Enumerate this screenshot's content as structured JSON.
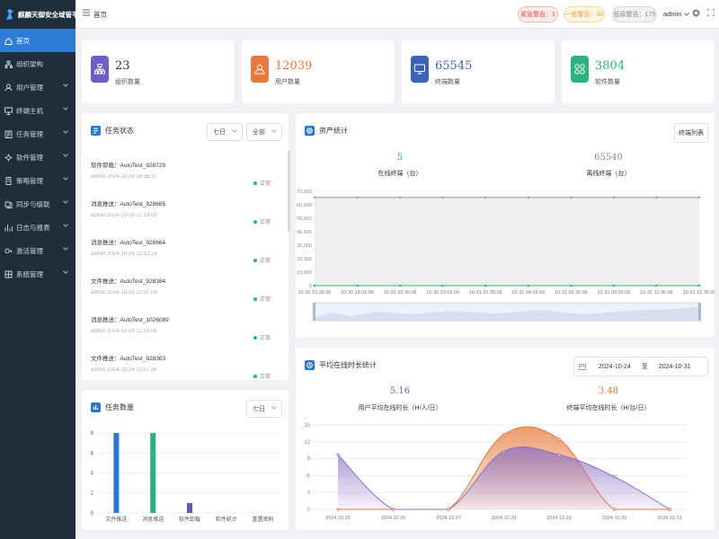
{
  "app": {
    "title": "麒麟天御安全域管平台"
  },
  "sidebar": {
    "items": [
      {
        "label": "首页",
        "icon": "home-icon",
        "active": true,
        "has_children": false
      },
      {
        "label": "组织架构",
        "icon": "org-icon",
        "has_children": false
      },
      {
        "label": "用户管理",
        "icon": "user-icon",
        "has_children": true
      },
      {
        "label": "终端主机",
        "icon": "monitor-icon",
        "has_children": true
      },
      {
        "label": "任务管理",
        "icon": "task-icon",
        "has_children": true
      },
      {
        "label": "软件管理",
        "icon": "gear-icon",
        "has_children": true
      },
      {
        "label": "策略管理",
        "icon": "policy-icon",
        "has_children": true
      },
      {
        "label": "同步与级联",
        "icon": "sync-icon",
        "has_children": true
      },
      {
        "label": "日志与报表",
        "icon": "chart-icon",
        "has_children": true
      },
      {
        "label": "激活管理",
        "icon": "key-icon",
        "has_children": true
      },
      {
        "label": "系统管理",
        "icon": "settings-icon",
        "has_children": true
      }
    ]
  },
  "header": {
    "breadcrumb": "首页",
    "alerts": {
      "urgent": "紧急警告：1",
      "normal": "一般警告：33",
      "low": "低级警告：175"
    },
    "user": "admin"
  },
  "stats": [
    {
      "value": "23",
      "label": "组织数量",
      "color": "#6c5fc7",
      "icon": "org-icon"
    },
    {
      "value": "12039",
      "label": "用户数量",
      "color": "#e8793a",
      "icon": "user-icon"
    },
    {
      "value": "65545",
      "label": "终端数量",
      "color": "#3b63b8",
      "icon": "monitor-icon"
    },
    {
      "value": "3804",
      "label": "软件数量",
      "color": "#2db080",
      "icon": "apps-icon"
    }
  ],
  "task_status": {
    "title": "任务状态",
    "filter_period": "七日",
    "filter_type": "全部",
    "items": [
      {
        "name": "软件卸载：AutoTest_928729",
        "meta": "admin   2024-10-29 19:56:37",
        "status": "正常"
      },
      {
        "name": "消息推送：AutoTest_928665",
        "meta": "admin   2024-10-29 12:13:09",
        "status": "正常"
      },
      {
        "name": "消息推送：AutoTest_928664",
        "meta": "admin   2024-10-29 12:12:18",
        "status": "正常"
      },
      {
        "name": "文件推送：AutoTest_928384",
        "meta": "admin   2024-10-29 12:07:09",
        "status": "正常"
      },
      {
        "name": "消息推送：AutoTest_1026089",
        "meta": "admin   2024-10-29 12:03:08",
        "status": "正常"
      },
      {
        "name": "文件推送：AutoTest_928363",
        "meta": "admin   2024-10-29 11:57:26",
        "status": "正常"
      }
    ]
  },
  "task_count": {
    "title": "任务数量",
    "filter_period": "七日"
  },
  "asset": {
    "title": "资产统计",
    "button": "终端列表",
    "online": {
      "value": "5",
      "label": "在线终端（台）"
    },
    "offline": {
      "value": "65540",
      "label": "离线终端（台）"
    }
  },
  "avg_online": {
    "title": "平均在线时长统计",
    "date_start": "2024-10-24",
    "date_sep": "至",
    "date_end": "2024-10-31",
    "user_avg": {
      "value": "5.16",
      "label": "用户平均在线时长（H/人/日）"
    },
    "term_avg": {
      "value": "3.48",
      "label": "终端平均在线时长（H/台/日）"
    }
  },
  "chart_data": [
    {
      "type": "bar",
      "categories": [
        "文件推送",
        "消息推送",
        "软件卸载",
        "软件统计",
        "重置密码"
      ],
      "values": [
        8,
        8,
        1,
        0,
        0
      ],
      "colors": [
        "#2a78c8",
        "#2db080",
        "#5a5fb8",
        "#5a5fb8",
        "#5a5fb8"
      ],
      "ylim": [
        0,
        8
      ],
      "yticks": [
        0,
        2,
        4,
        6,
        8
      ],
      "grid": true
    },
    {
      "type": "line",
      "categories": [
        "10-30 15:35:06",
        "10-30 18:05:06",
        "10-30 20:35:06",
        "10-30 23:05:06",
        "10-31 01:35:06",
        "10-31 04:05:06",
        "10-31 06:35:06",
        "10-31 09:05:06",
        "10-31 11:35:06",
        "10-31 15:35:06"
      ],
      "series": [
        {
          "values": [
            65540,
            65540,
            65540,
            65540,
            65540,
            65540,
            65540,
            65540,
            65540,
            65540
          ],
          "color": "#999999"
        },
        {
          "values": [
            5,
            5,
            5,
            5,
            5,
            5,
            5,
            5,
            5,
            5
          ],
          "color": "#2bb673"
        }
      ],
      "ylim": [
        0,
        70000
      ],
      "yticks": [
        0,
        10000,
        20000,
        30000,
        40000,
        50000,
        60000,
        70000
      ],
      "grid": true,
      "datazoom": true
    },
    {
      "type": "area",
      "categories": [
        "2024.10.25",
        "2024.10.26",
        "2024.10.27",
        "2024.10.28",
        "2024.10.29",
        "2024.10.30",
        "2024.10.31"
      ],
      "series": [
        {
          "values": [
            9.7,
            0,
            0,
            10.3,
            9.7,
            5.8,
            0
          ],
          "color": "#8a6fc4"
        },
        {
          "values": [
            0,
            0,
            0,
            13.3,
            12.5,
            0,
            0
          ],
          "color": "#e8793a"
        }
      ],
      "ylim": [
        0,
        15
      ],
      "yticks": [
        0,
        3,
        6,
        9,
        12,
        15
      ],
      "grid": true
    }
  ]
}
